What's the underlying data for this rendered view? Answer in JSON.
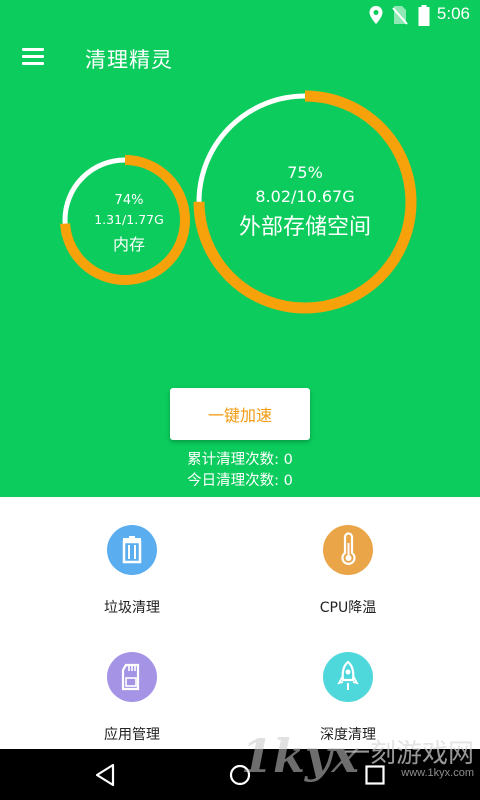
{
  "status_bar": {
    "time": "5:06",
    "icons": [
      "location-icon",
      "no-sim-icon",
      "battery-icon"
    ]
  },
  "app_bar": {
    "title": "清理精灵",
    "menu_icon": "hamburger-menu-icon"
  },
  "memory": {
    "percent": "74%",
    "usage": "1.31/1.77G",
    "label": "内存",
    "used_fraction": 0.74
  },
  "external_storage": {
    "percent": "75%",
    "usage": "8.02/10.67G",
    "label": "外部存储空间",
    "used_fraction": 0.75
  },
  "boost_button": {
    "label": "一键加速"
  },
  "counts": {
    "total": "累计清理次数: 0",
    "today": "今日清理次数: 0"
  },
  "tools": [
    {
      "label": "垃圾清理",
      "icon": "trash-icon",
      "color": "#5aaef0"
    },
    {
      "label": "CPU降温",
      "icon": "thermometer-icon",
      "color": "#e9a548"
    },
    {
      "label": "应用管理",
      "icon": "sd-card-icon",
      "color": "#a594e6"
    },
    {
      "label": "深度清理",
      "icon": "rocket-icon",
      "color": "#4fd8dc"
    }
  ],
  "nav_bar": {
    "buttons": [
      "back-icon",
      "home-icon",
      "recents-icon"
    ]
  },
  "watermark": {
    "logo": "1kyx",
    "text": "一刻游戏网",
    "url": "www.1kyx.com"
  },
  "colors": {
    "primary_green": "#0bcc5c",
    "gauge_orange": "#f7a20a",
    "gauge_track": "#ffffff",
    "button_text": "#f19b12"
  }
}
